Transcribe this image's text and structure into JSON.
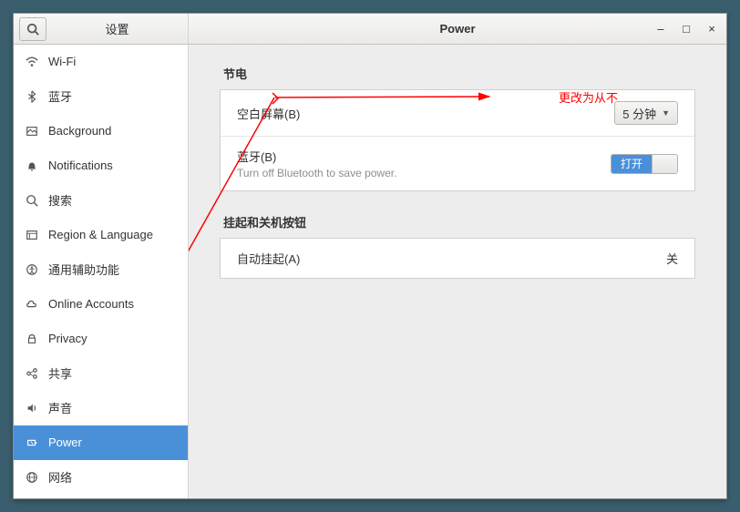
{
  "header": {
    "settings_title": "设置",
    "page_title": "Power"
  },
  "sidebar": {
    "items": [
      {
        "label": "Wi-Fi"
      },
      {
        "label": "蓝牙"
      },
      {
        "label": "Background"
      },
      {
        "label": "Notifications"
      },
      {
        "label": "搜索"
      },
      {
        "label": "Region & Language"
      },
      {
        "label": "通用辅助功能"
      },
      {
        "label": "Online Accounts"
      },
      {
        "label": "Privacy"
      },
      {
        "label": "共享"
      },
      {
        "label": "声音"
      },
      {
        "label": "Power"
      },
      {
        "label": "网络"
      }
    ]
  },
  "sections": {
    "power_saving_title": "节电",
    "suspend_title": "挂起和关机按钮"
  },
  "rows": {
    "blank_screen_label": "空白屏幕(B)",
    "blank_screen_value": "5 分钟",
    "bluetooth_label": "蓝牙(B)",
    "bluetooth_sub": "Turn off Bluetooth to save power.",
    "bluetooth_switch": "打开",
    "auto_suspend_label": "自动挂起(A)",
    "auto_suspend_value": "关"
  },
  "annotation": {
    "text": "更改为从不"
  }
}
